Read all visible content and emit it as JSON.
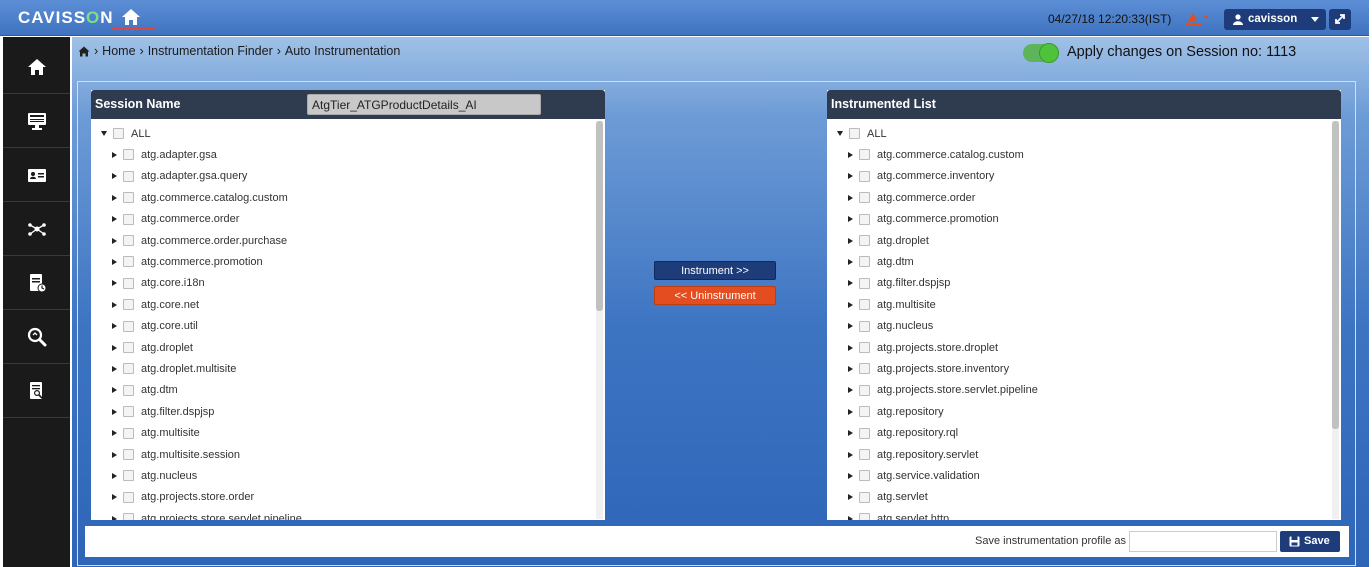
{
  "header": {
    "logo_left": "CAVISS",
    "logo_o": "O",
    "logo_right": "N",
    "datetime": "04/27/18 12:20:33(IST)",
    "user": "cavisson"
  },
  "sidebar": {
    "items": [
      {
        "name": "home"
      },
      {
        "name": "monitor"
      },
      {
        "name": "id-card"
      },
      {
        "name": "network"
      },
      {
        "name": "report"
      },
      {
        "name": "search-zoom"
      },
      {
        "name": "document-search"
      }
    ]
  },
  "breadcrumb": {
    "home": "Home",
    "item2": "Instrumentation Finder",
    "item3": "Auto Instrumentation"
  },
  "session": {
    "label": "Apply changes on Session no: 1113",
    "toggle_on": true
  },
  "left_panel": {
    "title": "Session Name",
    "session_name": "AtgTier_ATGProductDetails_AI",
    "root": "ALL",
    "items": [
      "atg.adapter.gsa",
      "atg.adapter.gsa.query",
      "atg.commerce.catalog.custom",
      "atg.commerce.order",
      "atg.commerce.order.purchase",
      "atg.commerce.promotion",
      "atg.core.i18n",
      "atg.core.net",
      "atg.core.util",
      "atg.droplet",
      "atg.droplet.multisite",
      "atg.dtm",
      "atg.filter.dspjsp",
      "atg.multisite",
      "atg.multisite.session",
      "atg.nucleus",
      "atg.projects.store.order",
      "atg.projects.store.servlet.pipeline"
    ]
  },
  "right_panel": {
    "title": "Instrumented List",
    "root": "ALL",
    "items": [
      "atg.commerce.catalog.custom",
      "atg.commerce.inventory",
      "atg.commerce.order",
      "atg.commerce.promotion",
      "atg.droplet",
      "atg.dtm",
      "atg.filter.dspjsp",
      "atg.multisite",
      "atg.nucleus",
      "atg.projects.store.droplet",
      "atg.projects.store.inventory",
      "atg.projects.store.servlet.pipeline",
      "atg.repository",
      "atg.repository.rql",
      "atg.repository.servlet",
      "atg.service.validation",
      "atg.servlet",
      "atg.servlet.http"
    ]
  },
  "actions": {
    "instrument": "Instrument >>",
    "uninstrument": "<< Uninstrument"
  },
  "footer": {
    "label": "Save instrumentation profile as",
    "input_value": "",
    "save": "Save"
  }
}
